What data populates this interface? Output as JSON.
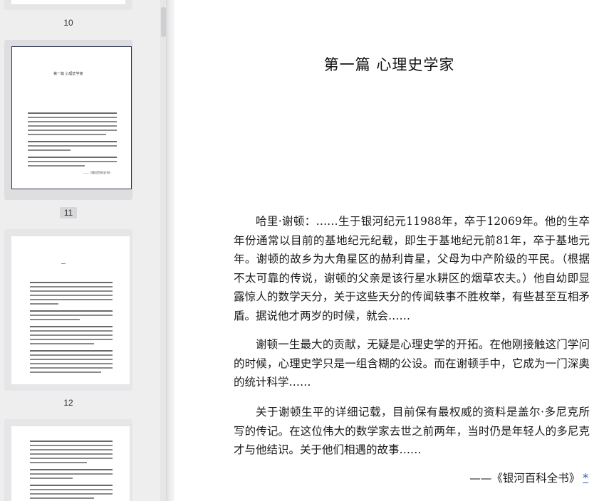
{
  "sidebar": {
    "pages": [
      {
        "number": "10"
      },
      {
        "number": "11",
        "selected": true
      },
      {
        "number": "12"
      }
    ],
    "thumb_chapter_title": "第一篇  心理史学家",
    "thumb_attribution": "——《银河百科全书》"
  },
  "page": {
    "chapter_title": "第一篇  心理史学家",
    "paragraphs": [
      "哈里·谢顿：……生于银河纪元11988年，卒于12069年。他的生卒年份通常以目前的基地纪元纪载，即生于基地纪元前81年，卒于基地元年。谢顿的故乡为大角星区的赫利肯星，父母为中产阶级的平民。（根据不太可靠的传说，谢顿的父亲是该行星水耕区的烟草农夫。）他自幼即显露惊人的数学天分，关于这些天分的传闻轶事不胜枚举，有些甚至互相矛盾。据说他才两岁的时候，就会……",
      "谢顿一生最大的贡献，无疑是心理史学的开拓。在他刚接触这门学问的时候，心理史学只是一组含糊的公设。而在谢顿手中，它成为一门深奥的统计科学……",
      "关于谢顿生平的详细记载，目前保有最权威的资料是盖尔·多尼克所写的传记。在这位伟大的数学家去世之前两年，当时仍是年轻人的多尼克才与他结识。关于他们相遇的故事……"
    ],
    "attribution": "——《银河百科全书》",
    "footnote_marker": "*"
  }
}
